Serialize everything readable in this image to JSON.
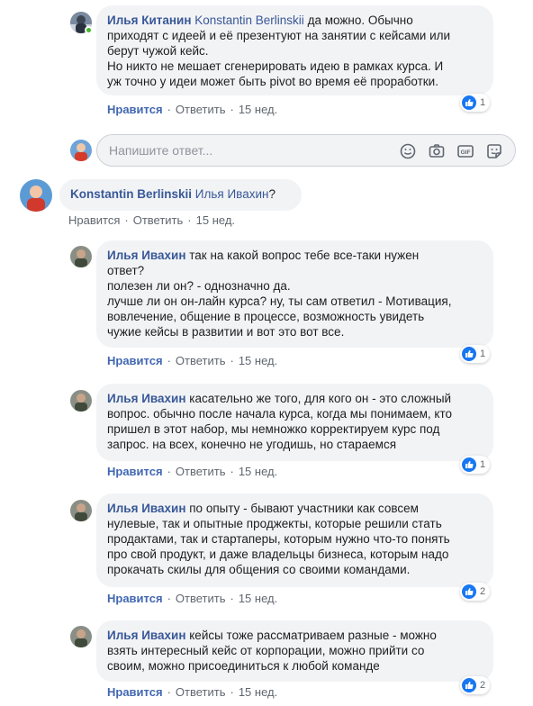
{
  "comments": [
    {
      "author": "Илья Китанин",
      "lines": [
        {
          "mention": "Konstantin Berlinskii",
          "text": " да можно. Обычно"
        },
        {
          "text": "приходят с идеей и её презентуют на занятии с кейсами или"
        },
        {
          "text": "берут чужой кейс."
        },
        {
          "text": "Но никто не мешает сгенерировать идею в рамках курса. И"
        },
        {
          "text": "уж точно у идеи может быть pivot во время её проработки."
        }
      ],
      "like_label": "Нравится",
      "reply_label": "Ответить",
      "time": "15 нед.",
      "reactions": "1"
    },
    {
      "author": "Konstantin Berlinskii",
      "lines": [
        {
          "mention": "Илья Ивахин",
          "text": "?"
        }
      ],
      "like_label": "Нравится",
      "reply_label": "Ответить",
      "time": "15 нед."
    },
    {
      "author": "Илья Ивахин",
      "lines": [
        {
          "text": " так на какой вопрос тебе все-таки нужен"
        },
        {
          "text": "ответ?"
        },
        {
          "text": "полезен ли он? - однозначно да."
        },
        {
          "text": "лучше ли он он-лайн курса? ну, ты сам ответил - Мотивация,"
        },
        {
          "text": "вовлечение, общение в процессе, возможность увидеть"
        },
        {
          "text": "чужие кейсы в развитии и вот это вот все."
        }
      ],
      "like_label": "Нравится",
      "reply_label": "Ответить",
      "time": "15 нед.",
      "reactions": "1"
    },
    {
      "author": "Илья Ивахин",
      "lines": [
        {
          "text": " касательно же того, для кого он - это сложный"
        },
        {
          "text": "вопрос. обычно после начала курса, когда мы понимаем, кто"
        },
        {
          "text": "пришел в этот набор, мы немножко корректируем курс под"
        },
        {
          "text": "запрос. на всех, конечно не угодишь, но стараемся"
        }
      ],
      "like_label": "Нравится",
      "reply_label": "Ответить",
      "time": "15 нед.",
      "reactions": "1"
    },
    {
      "author": "Илья Ивахин",
      "lines": [
        {
          "text": " по опыту - бывают участники как совсем"
        },
        {
          "text": "нулевые, так и опытные проджекты, которые решили стать"
        },
        {
          "text": "продактами, так и стартаперы, которым нужно что-то понять"
        },
        {
          "text": "про свой продукт, и даже владельцы бизнеса, которым надо"
        },
        {
          "text": "прокачать скилы для общения со своими командами."
        }
      ],
      "like_label": "Нравится",
      "reply_label": "Ответить",
      "time": "15 нед.",
      "reactions": "2"
    },
    {
      "author": "Илья Ивахин",
      "lines": [
        {
          "text": " кейсы тоже рассматриваем разные - можно"
        },
        {
          "text": "взять интересный кейс от корпорации, можно прийти со"
        },
        {
          "text": "своим, можно присоединиться к любой команде"
        }
      ],
      "like_label": "Нравится",
      "reply_label": "Ответить",
      "time": "15 нед.",
      "reactions": "2"
    }
  ],
  "reply_box": {
    "placeholder": "Напишите ответ...",
    "icons": [
      "smiley-icon",
      "camera-icon",
      "gif-icon",
      "sticker-icon"
    ]
  },
  "colors": {
    "link": "#385898",
    "like": "#4267b2",
    "bubble": "#f2f3f5",
    "reaction_blue": "#1877f2",
    "online": "#42b72a"
  }
}
